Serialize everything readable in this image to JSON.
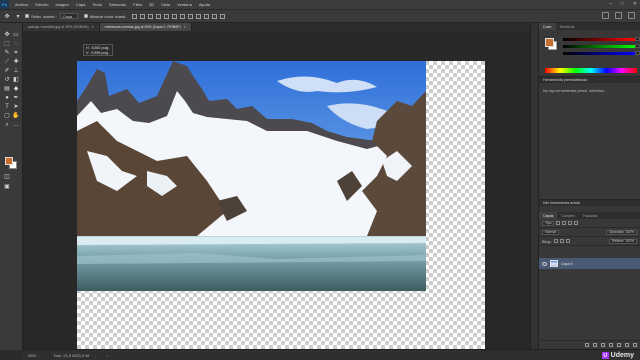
{
  "app": {
    "logo_text": "Ps"
  },
  "menu": [
    "Archivo",
    "Edición",
    "Imagen",
    "Capa",
    "Texto",
    "Selección",
    "Filtro",
    "3D",
    "Vista",
    "Ventana",
    "Ayuda"
  ],
  "window_controls": {
    "minimize": "–",
    "maximize": "□",
    "close": "✕"
  },
  "options_bar": {
    "auto_select_label": "Selec. autom.:",
    "auto_select_value": "Capa",
    "transform_label": "Mostrar contr. transf."
  },
  "tabs": [
    {
      "label": "paisaje-montaña.jpg al 25% (RGB/8#)",
      "close": "×",
      "active": false
    },
    {
      "label": "referencia-normas.jpg al 25% (Capa 0, RGB/8*)",
      "close": "×",
      "active": true
    }
  ],
  "tooltip": {
    "line1": "H : 8,853 pulg.",
    "line2": "V : 5,896 pulg."
  },
  "status": {
    "zoom": "25%",
    "doc": "Doc: 21,9 M/21,9 M",
    "arrow": "›"
  },
  "watermark": {
    "brand": "Udemy",
    "mark": "U"
  },
  "panels": {
    "color_tabs": [
      "Color",
      "Muestras"
    ],
    "presets_title": "Herramienta preestablecida",
    "presets_empty": "No hay herramientas preesl. definidas...",
    "props_title": "Info herramienta actual",
    "layers_tabs": [
      "Capas",
      "Canales",
      "Trazados"
    ],
    "kind_label": "Tipo",
    "blend_mode": "Normal",
    "opacity_label": "Opacidad: 100%",
    "lock_label": "Bloq.:",
    "fill_label": "Relleno: 100%",
    "layer_name": "Capa 0"
  },
  "colors": {
    "foreground": "#c86e2e",
    "background": "#ffffff",
    "layer_selected": "#4a5a74"
  }
}
